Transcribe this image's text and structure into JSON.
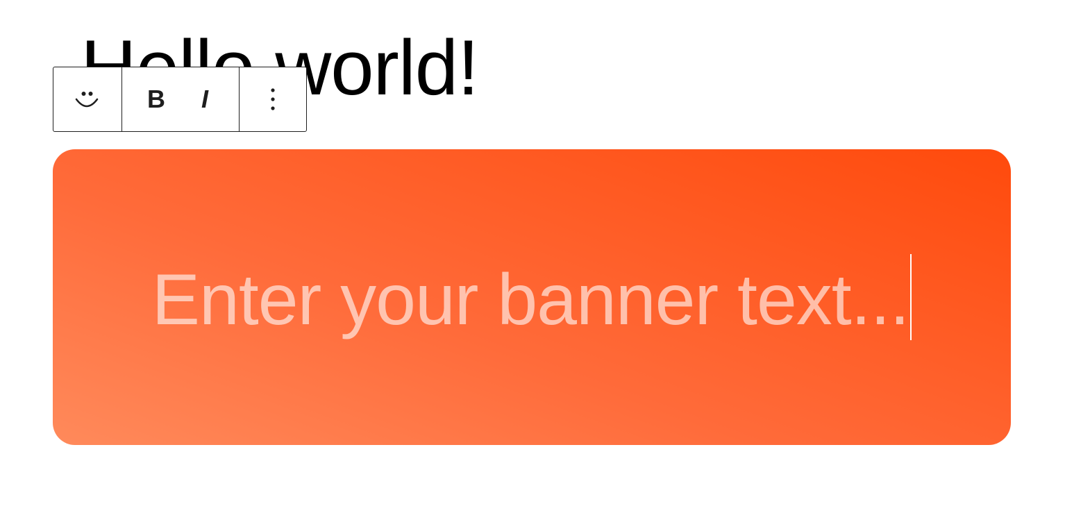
{
  "heading": {
    "text": "Hello world!"
  },
  "toolbar": {
    "emoji_icon": "smile-icon",
    "bold_label": "B",
    "italic_label": "I",
    "more_icon": "more-vertical-icon"
  },
  "banner": {
    "placeholder": "Enter your banner text...",
    "gradient_start": "#ff8a5b",
    "gradient_end": "#ff4a0c",
    "text_color": "rgba(255,255,255,0.6)"
  }
}
